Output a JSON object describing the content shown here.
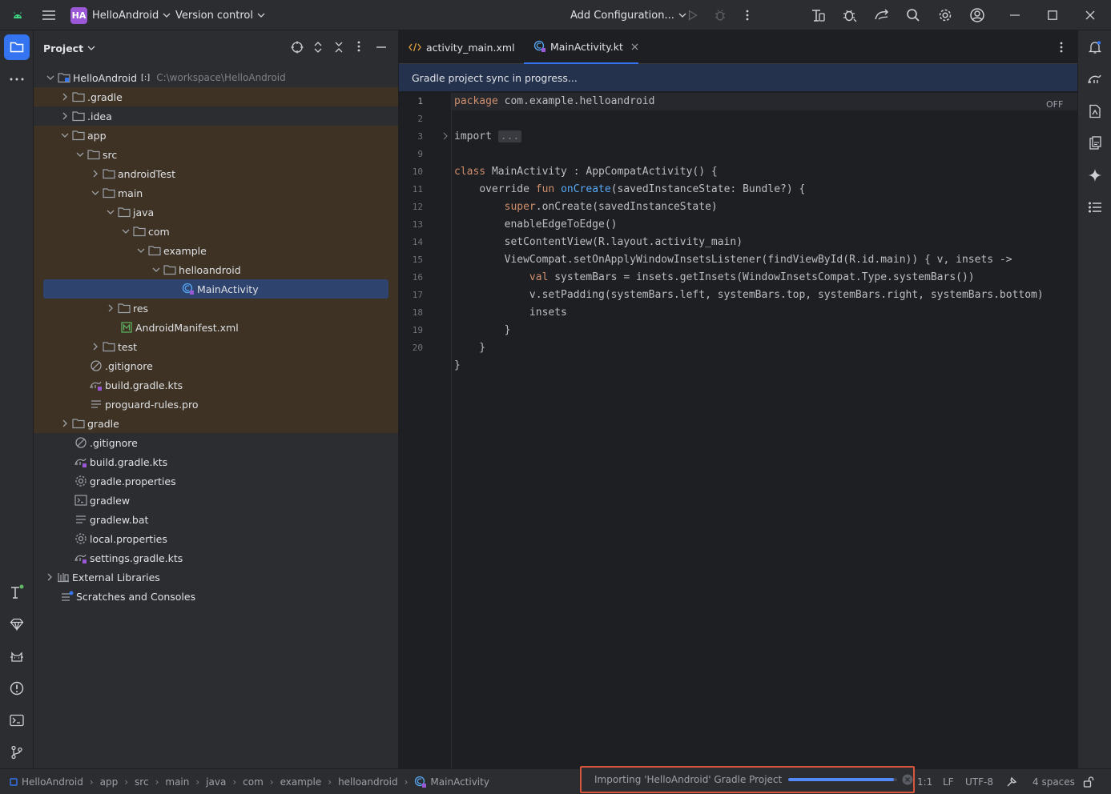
{
  "titlebar": {
    "project_badge": "HA",
    "project_name": "HelloAndroid",
    "vcs_menu": "Version control",
    "run_config": "Add Configuration..."
  },
  "colors": {
    "accent": "#3574f0",
    "badge": "#9a57d6",
    "modified_row": "#3d3223",
    "selection": "#2e436e",
    "keyword": "#cf8e6d",
    "function": "#56a8f5",
    "highlight_box": "#d6553c"
  },
  "project_panel": {
    "title": "Project",
    "tree": [
      {
        "label": "HelloAndroid",
        "path": "C:\\workspace\\HelloAndroid",
        "module_mark": "[:]"
      },
      {
        "label": ".gradle"
      },
      {
        "label": ".idea"
      },
      {
        "label": "app"
      },
      {
        "label": "src"
      },
      {
        "label": "androidTest"
      },
      {
        "label": "main"
      },
      {
        "label": "java"
      },
      {
        "label": "com"
      },
      {
        "label": "example"
      },
      {
        "label": "helloandroid"
      },
      {
        "label": "MainActivity"
      },
      {
        "label": "res"
      },
      {
        "label": "AndroidManifest.xml"
      },
      {
        "label": "test"
      },
      {
        "label": ".gitignore"
      },
      {
        "label": "build.gradle.kts"
      },
      {
        "label": "proguard-rules.pro"
      },
      {
        "label": "gradle"
      },
      {
        "label": ".gitignore"
      },
      {
        "label": "build.gradle.kts"
      },
      {
        "label": "gradle.properties"
      },
      {
        "label": "gradlew"
      },
      {
        "label": "gradlew.bat"
      },
      {
        "label": "local.properties"
      },
      {
        "label": "settings.gradle.kts"
      },
      {
        "label": "External Libraries"
      },
      {
        "label": "Scratches and Consoles"
      }
    ]
  },
  "editor": {
    "tabs": [
      {
        "label": "activity_main.xml"
      },
      {
        "label": "MainActivity.kt"
      }
    ],
    "banner": "Gradle project sync in progress...",
    "off_label": "OFF",
    "line_numbers": [
      "1",
      "2",
      "3",
      "9",
      "10",
      "11",
      "12",
      "13",
      "14",
      "15",
      "16",
      "17",
      "18",
      "19",
      "20"
    ],
    "code": {
      "l1_kw": "package",
      "l1_rest": " com.example.helloandroid",
      "l3_kw": "import",
      "l3_fold": "...",
      "l9_kw": "class",
      "l9_rest": " MainActivity : AppCompatActivity() {",
      "l10_indent": "    ",
      "l10_kw1": "override",
      "l10_kw2": "fun",
      "l10_fn": "onCreate",
      "l10_rest": "(savedInstanceState: Bundle?) {",
      "l11_indent": "        ",
      "l11_kw": "super",
      "l11_rest": ".onCreate(savedInstanceState)",
      "l12": "        enableEdgeToEdge()",
      "l13": "        setContentView(R.layout.activity_main)",
      "l14": "        ViewCompat.setOnApplyWindowInsetsListener(findViewById(R.id.main)) { v, insets ->",
      "l15_indent": "            ",
      "l15_kw": "val",
      "l15_rest": " systemBars = insets.getInsets(WindowInsetsCompat.Type.systemBars())",
      "l16": "            v.setPadding(systemBars.left, systemBars.top, systemBars.right, systemBars.bottom)",
      "l17": "            insets",
      "l18": "        }",
      "l19": "    }",
      "l20": "}"
    }
  },
  "statusbar": {
    "breadcrumbs": [
      "HelloAndroid",
      "app",
      "src",
      "main",
      "java",
      "com",
      "example",
      "helloandroid",
      "MainActivity"
    ],
    "progress_text": "Importing 'HelloAndroid' Gradle Project",
    "progress_fraction": 0.97,
    "caret": "1:1",
    "line_sep": "LF",
    "encoding": "UTF-8",
    "indent": "4 spaces"
  }
}
